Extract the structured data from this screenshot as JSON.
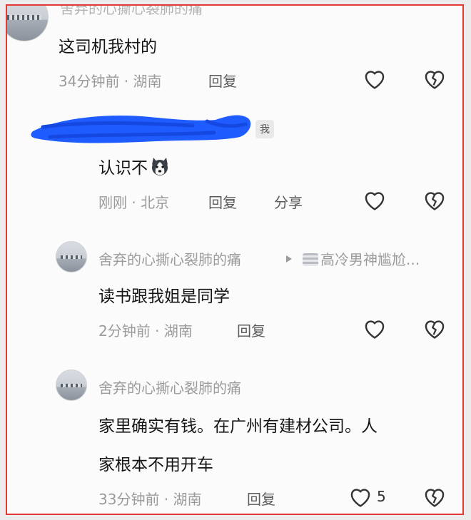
{
  "comments": [
    {
      "username": "舍弃的心撕心裂肺的痛",
      "text": "这司机我村的",
      "time": "34分钟前",
      "location": "湖南",
      "reply_label": "回复"
    },
    {
      "me_badge": "我",
      "text": "认识不",
      "emoji_icon": "husky-dog-emoji-icon",
      "time": "刚刚",
      "location": "北京",
      "reply_label": "回复",
      "share_label": "分享"
    },
    {
      "username": "舍弃的心撕心裂肺的痛",
      "reply_to": "高冷男神尴尬...",
      "text": "读书跟我姐是同学",
      "time": "2分钟前",
      "location": "湖南",
      "reply_label": "回复"
    },
    {
      "username": "舍弃的心撕心裂肺的痛",
      "text_line1": "家里确实有钱。在广州有建材公司。人",
      "text_line2": "家根本不用开车",
      "time": "33分钟前",
      "location": "湖南",
      "reply_label": "回复",
      "like_count": "5"
    }
  ],
  "separator": " · ",
  "colors": {
    "highlight_border": "#e53935",
    "redaction": "#1f5cff"
  }
}
